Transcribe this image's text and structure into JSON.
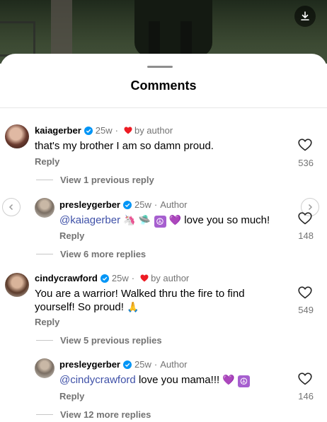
{
  "header": {
    "title": "Comments"
  },
  "comments": [
    {
      "username": "kaiagerber",
      "time": "25w",
      "separator": "·",
      "badge": "by author",
      "text": "that's my brother I am so damn proud.",
      "reply_label": "Reply",
      "likes": "536",
      "thread_link": "View 1 previous reply"
    },
    {
      "username": "presleygerber",
      "time": "25w",
      "separator": "·",
      "badge": "Author",
      "mention": "@kaiagerber",
      "text": "love you so much!",
      "reply_label": "Reply",
      "likes": "148",
      "thread_link": "View 6 more replies"
    },
    {
      "username": "cindycrawford",
      "time": "25w",
      "separator": "·",
      "badge": "by author",
      "text_line1": "You are a warrior!  Walked thru the fire to find",
      "text_line2": "yourself!  So proud!",
      "reply_label": "Reply",
      "likes": "549",
      "thread_link": "View 5 previous replies"
    },
    {
      "username": "presleygerber",
      "time": "25w",
      "separator": "·",
      "badge": "Author",
      "mention": "@cindycrawford",
      "text": "love you mama!!!",
      "reply_label": "Reply",
      "likes": "146",
      "thread_link": "View 12 more replies"
    }
  ],
  "emojis": {
    "unicorn": "🦄",
    "saucer": "🛸",
    "peace": "☮",
    "purple_heart": "💜",
    "pray": "🙏"
  },
  "colors": {
    "verified": "#0095f6",
    "heart_red": "#ed1c24",
    "mention": "#3f51a8",
    "muted": "#737373"
  },
  "icons": {
    "download": "download-icon",
    "like": "heart-outline-icon",
    "verified": "verified-badge-icon",
    "prev": "chevron-left-icon",
    "next": "chevron-right-icon"
  }
}
